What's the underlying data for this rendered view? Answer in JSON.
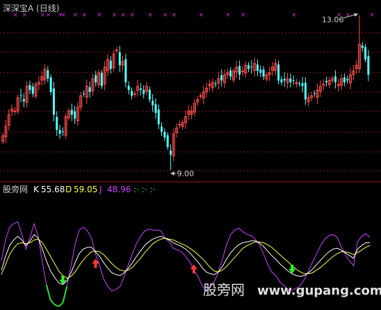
{
  "chart_data": [
    {
      "type": "candlestick",
      "title": "深深宝A (日线)",
      "y_range": [
        9.0,
        13.06
      ],
      "annotations": {
        "high_label": "13.06",
        "low_label": "9.00"
      },
      "marker_glyph": "×",
      "colors": {
        "up": "#ff4d4d",
        "down": "#54ffff",
        "title": "#cccccc",
        "grid": "#8a1c1c",
        "marker": "#cc33cc",
        "annot": "#cfcfcf"
      },
      "closes": [
        9.9,
        10.15,
        10.45,
        10.6,
        10.55,
        10.9,
        10.95,
        10.8,
        11.2,
        11.1,
        11.0,
        11.25,
        11.3,
        11.45,
        11.65,
        11.4,
        11.05,
        10.45,
        10.05,
        9.95,
        10.0,
        10.4,
        10.55,
        10.45,
        10.35,
        10.65,
        10.95,
        11.0,
        11.2,
        11.05,
        11.4,
        11.3,
        11.55,
        11.2,
        11.7,
        11.9,
        11.65,
        12.05,
        12.15,
        11.75,
        11.85,
        11.3,
        11.1,
        10.95,
        11.0,
        11.2,
        11.1,
        11.0,
        11.2,
        10.85,
        10.7,
        10.5,
        10.2,
        10.0,
        9.85,
        9.6,
        9.4,
        9.95,
        10.1,
        10.2,
        10.25,
        10.4,
        10.55,
        10.55,
        10.75,
        10.85,
        10.95,
        11.05,
        11.15,
        11.25,
        11.3,
        11.25,
        11.4,
        11.35,
        11.5,
        11.55,
        11.45,
        11.6,
        11.7,
        11.5,
        11.6,
        11.75,
        11.65,
        11.7,
        11.8,
        11.6,
        11.55,
        11.45,
        11.5,
        11.55,
        11.7,
        11.8,
        11.35,
        11.3,
        11.35,
        11.4,
        11.3,
        11.35,
        11.3,
        11.25,
        11.2,
        10.85,
        10.9,
        10.95,
        11.0,
        11.1,
        11.2,
        11.25,
        11.3,
        11.35,
        11.4,
        11.3,
        11.25,
        11.4,
        11.3,
        11.35,
        11.5,
        11.6,
        11.75,
        12.3,
        12.2,
        11.9,
        11.5
      ],
      "markers": [
        4,
        7,
        13,
        15,
        19,
        20,
        24,
        27,
        32,
        37,
        40,
        43,
        49,
        54,
        57,
        66,
        75,
        80,
        97,
        112,
        115,
        123
      ]
    },
    {
      "type": "line",
      "title": "股旁网",
      "legend": [
        {
          "name": "K",
          "value": "55.68",
          "color": "#ffffff"
        },
        {
          "name": "D",
          "value": "59.05",
          "color": "#ffff4d"
        },
        {
          "name": "J",
          "value": "48.96",
          "color": "#cc44ff"
        }
      ],
      "legend_trail": ":·  :·  :·",
      "trail_color": "#33dd33",
      "y_range": [
        -15,
        115
      ],
      "series": [
        {
          "name": "K",
          "color": "#ffffff",
          "values": [
            25,
            40,
            52,
            58,
            62,
            58,
            52,
            57,
            64,
            60,
            48,
            35,
            24,
            17,
            11,
            9,
            13,
            22,
            33,
            43,
            48,
            50,
            50,
            45,
            40,
            33,
            27,
            22,
            20,
            19,
            22,
            27,
            33,
            40,
            46,
            52,
            56,
            59,
            61,
            62,
            60,
            58,
            55,
            53,
            51,
            48,
            44,
            39,
            34,
            28,
            23,
            21,
            20,
            23,
            29,
            37,
            44,
            49,
            53,
            55,
            56,
            57,
            57,
            55,
            51,
            46,
            41,
            37,
            32,
            28,
            24,
            21,
            19,
            18,
            19,
            22,
            26,
            31,
            36,
            41,
            45,
            48,
            49,
            47,
            44,
            41,
            38,
            48,
            52,
            55,
            55
          ]
        },
        {
          "name": "D",
          "color": "#ffff4d",
          "values": [
            20,
            31,
            42,
            49,
            54,
            55,
            54,
            55,
            58,
            59,
            55,
            48,
            40,
            32,
            24,
            19,
            16,
            18,
            23,
            30,
            36,
            41,
            45,
            46,
            45,
            42,
            37,
            32,
            28,
            25,
            24,
            25,
            28,
            33,
            38,
            44,
            49,
            54,
            57,
            59,
            60,
            59,
            58,
            56,
            54,
            52,
            49,
            46,
            42,
            38,
            33,
            28,
            24,
            23,
            25,
            29,
            34,
            39,
            44,
            49,
            52,
            54,
            56,
            56,
            55,
            53,
            50,
            46,
            42,
            38,
            34,
            30,
            26,
            23,
            21,
            21,
            22,
            25,
            28,
            32,
            36,
            40,
            43,
            45,
            45,
            44,
            42,
            44,
            47,
            50,
            52
          ]
        }
      ],
      "markers": [
        {
          "type": "sell",
          "x_index": 15,
          "color": "#33ee33"
        },
        {
          "type": "buy",
          "x_index": 23,
          "color": "#ff3a3a"
        },
        {
          "type": "buy",
          "x_index": 47,
          "color": "#ff3a3a"
        },
        {
          "type": "sell",
          "x_index": 71,
          "color": "#33ee33"
        },
        {
          "type": "buy",
          "x_index": 107,
          "color": "#ff3a3a"
        }
      ],
      "watermark": {
        "text": "股旁网",
        "url": "www.gupang.com",
        "color": "#e0e0e0"
      }
    }
  ]
}
